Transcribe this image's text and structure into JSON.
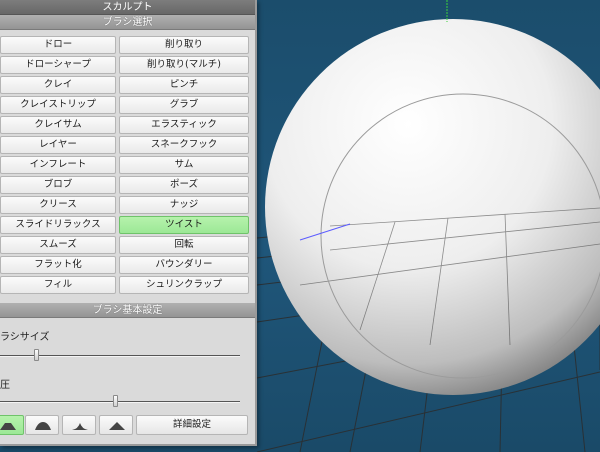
{
  "panel": {
    "title": "スカルプト",
    "brush_section_title": "ブラシ選択",
    "brushes": [
      {
        "label": "ドロー",
        "selected": false
      },
      {
        "label": "削り取り",
        "selected": false
      },
      {
        "label": "ドローシャープ",
        "selected": false
      },
      {
        "label": "削り取り(マルチ)",
        "selected": false
      },
      {
        "label": "クレイ",
        "selected": false
      },
      {
        "label": "ピンチ",
        "selected": false
      },
      {
        "label": "クレイストリップ",
        "selected": false
      },
      {
        "label": "グラブ",
        "selected": false
      },
      {
        "label": "クレイサム",
        "selected": false
      },
      {
        "label": "エラスティック",
        "selected": false
      },
      {
        "label": "レイヤー",
        "selected": false
      },
      {
        "label": "スネークフック",
        "selected": false
      },
      {
        "label": "インフレート",
        "selected": false
      },
      {
        "label": "サム",
        "selected": false
      },
      {
        "label": "ブロブ",
        "selected": false
      },
      {
        "label": "ポーズ",
        "selected": false
      },
      {
        "label": "クリース",
        "selected": false
      },
      {
        "label": "ナッジ",
        "selected": false
      },
      {
        "label": "スライドリラックス",
        "selected": false
      },
      {
        "label": "ツイスト",
        "selected": true
      },
      {
        "label": "スムーズ",
        "selected": false
      },
      {
        "label": "回転",
        "selected": false
      },
      {
        "label": "フラット化",
        "selected": false
      },
      {
        "label": "バウンダリー",
        "selected": false
      },
      {
        "label": "フィル",
        "selected": false
      },
      {
        "label": "シュリンクラップ",
        "selected": false
      }
    ],
    "basic_section_title": "ブラシ基本設定",
    "brush_size_label": "ラシサイズ",
    "brush_size_value": 0.14,
    "pressure_label": "圧",
    "pressure_value": 0.47,
    "stroke_presets": [
      {
        "icon": "falloff-sharp-icon",
        "selected": true
      },
      {
        "icon": "falloff-smooth-icon",
        "selected": false
      },
      {
        "icon": "falloff-medium-icon",
        "selected": false
      },
      {
        "icon": "falloff-peak-icon",
        "selected": false
      }
    ],
    "detail_button_label": "詳細設定"
  },
  "colors": {
    "viewport_bg": "#1d5272",
    "selected_green": "#a6ee9f",
    "panel_bg": "#dadada"
  }
}
